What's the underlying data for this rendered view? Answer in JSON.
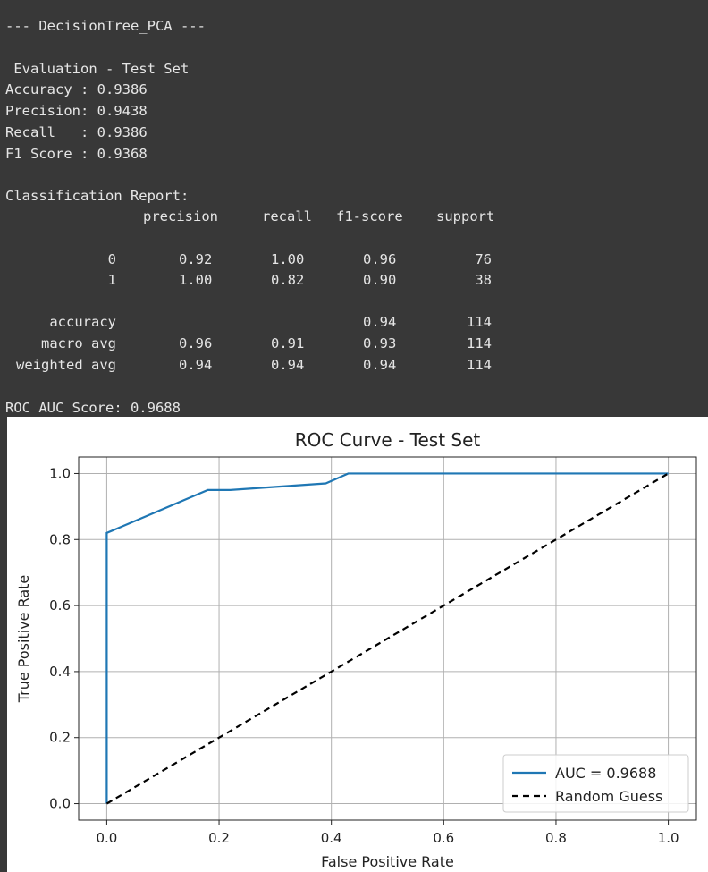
{
  "console": {
    "header": "--- DecisionTree_PCA ---",
    "eval_title": " Evaluation - Test Set",
    "metrics": [
      {
        "label": "Accuracy : ",
        "value": "0.9386"
      },
      {
        "label": "Precision: ",
        "value": "0.9438"
      },
      {
        "label": "Recall   : ",
        "value": "0.9386"
      },
      {
        "label": "F1 Score : ",
        "value": "0.9368"
      }
    ],
    "report_title": "Classification Report:",
    "report_columns": [
      "precision",
      "recall",
      "f1-score",
      "support"
    ],
    "report_rows": [
      {
        "label": "0",
        "precision": "0.92",
        "recall": "1.00",
        "f1": "0.96",
        "support": "76"
      },
      {
        "label": "1",
        "precision": "1.00",
        "recall": "0.82",
        "f1": "0.90",
        "support": "38"
      },
      {
        "label": "accuracy",
        "precision": "",
        "recall": "",
        "f1": "0.94",
        "support": "114"
      },
      {
        "label": "macro avg",
        "precision": "0.96",
        "recall": "0.91",
        "f1": "0.93",
        "support": "114"
      },
      {
        "label": "weighted avg",
        "precision": "0.94",
        "recall": "0.94",
        "f1": "0.94",
        "support": "114"
      }
    ],
    "roc_auc_line": "ROC AUC Score: 0.9688"
  },
  "chart_data": {
    "type": "line",
    "title": "ROC Curve - Test Set",
    "xlabel": "False Positive Rate",
    "ylabel": "True Positive Rate",
    "xlim": [
      -0.05,
      1.05
    ],
    "ylim": [
      -0.05,
      1.05
    ],
    "xticks": [
      0.0,
      0.2,
      0.4,
      0.6,
      0.8,
      1.0
    ],
    "yticks": [
      0.0,
      0.2,
      0.4,
      0.6,
      0.8,
      1.0
    ],
    "xtick_labels": [
      "0.0",
      "0.2",
      "0.4",
      "0.6",
      "0.8",
      "1.0"
    ],
    "ytick_labels": [
      "0.0",
      "0.2",
      "0.4",
      "0.6",
      "0.8",
      "1.0"
    ],
    "grid": true,
    "legend_position": "lower-right",
    "series": [
      {
        "name": "AUC = 0.9688",
        "color": "#1f77b4",
        "style": "solid",
        "x": [
          0.0,
          0.0,
          0.18,
          0.22,
          0.39,
          0.43,
          1.0
        ],
        "y": [
          0.0,
          0.82,
          0.95,
          0.95,
          0.97,
          1.0,
          1.0
        ]
      },
      {
        "name": "Random Guess",
        "color": "#000000",
        "style": "dashed",
        "x": [
          0.0,
          1.0
        ],
        "y": [
          0.0,
          1.0
        ]
      }
    ]
  }
}
